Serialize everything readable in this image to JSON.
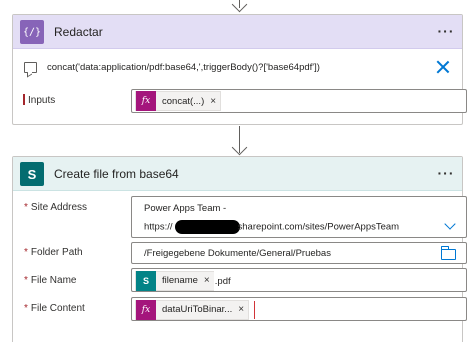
{
  "compose_card": {
    "title": "Redactar",
    "more_label": "···",
    "icon": "braces-icon",
    "icon_text": "{∕}",
    "expression": "concat('data:application/pdf:base64,',triggerBody()?['base64pdf'])",
    "inputs_label": "Inputs",
    "inputs_token": {
      "icon_text": "fx",
      "label": "concat(...)",
      "remove": "×"
    }
  },
  "create_card": {
    "title": "Create file from base64",
    "more_label": "···",
    "icon": "sharepoint-icon",
    "icon_text": "S",
    "site_address": {
      "label": "Site Address",
      "line1": "Power Apps Team -",
      "line2_prefix": "https://",
      "line2_suffix": "sharepoint.com/sites/PowerAppsTeam"
    },
    "folder_path": {
      "label": "Folder Path",
      "value": "/Freigegebene Dokumente/General/Pruebas"
    },
    "file_name": {
      "label": "File Name",
      "token": {
        "icon_text": "S",
        "label": "filename",
        "remove": "×"
      },
      "suffix": ".pdf"
    },
    "file_content": {
      "label": "File Content",
      "token": {
        "icon_text": "fx",
        "label": "dataUriToBinar...",
        "remove": "×"
      }
    },
    "required_mark": "*"
  },
  "colors": {
    "compose_accent": "#8764b8",
    "sharepoint_accent": "#036c70",
    "link_blue": "#0078d4",
    "required_red": "#a4262c"
  }
}
